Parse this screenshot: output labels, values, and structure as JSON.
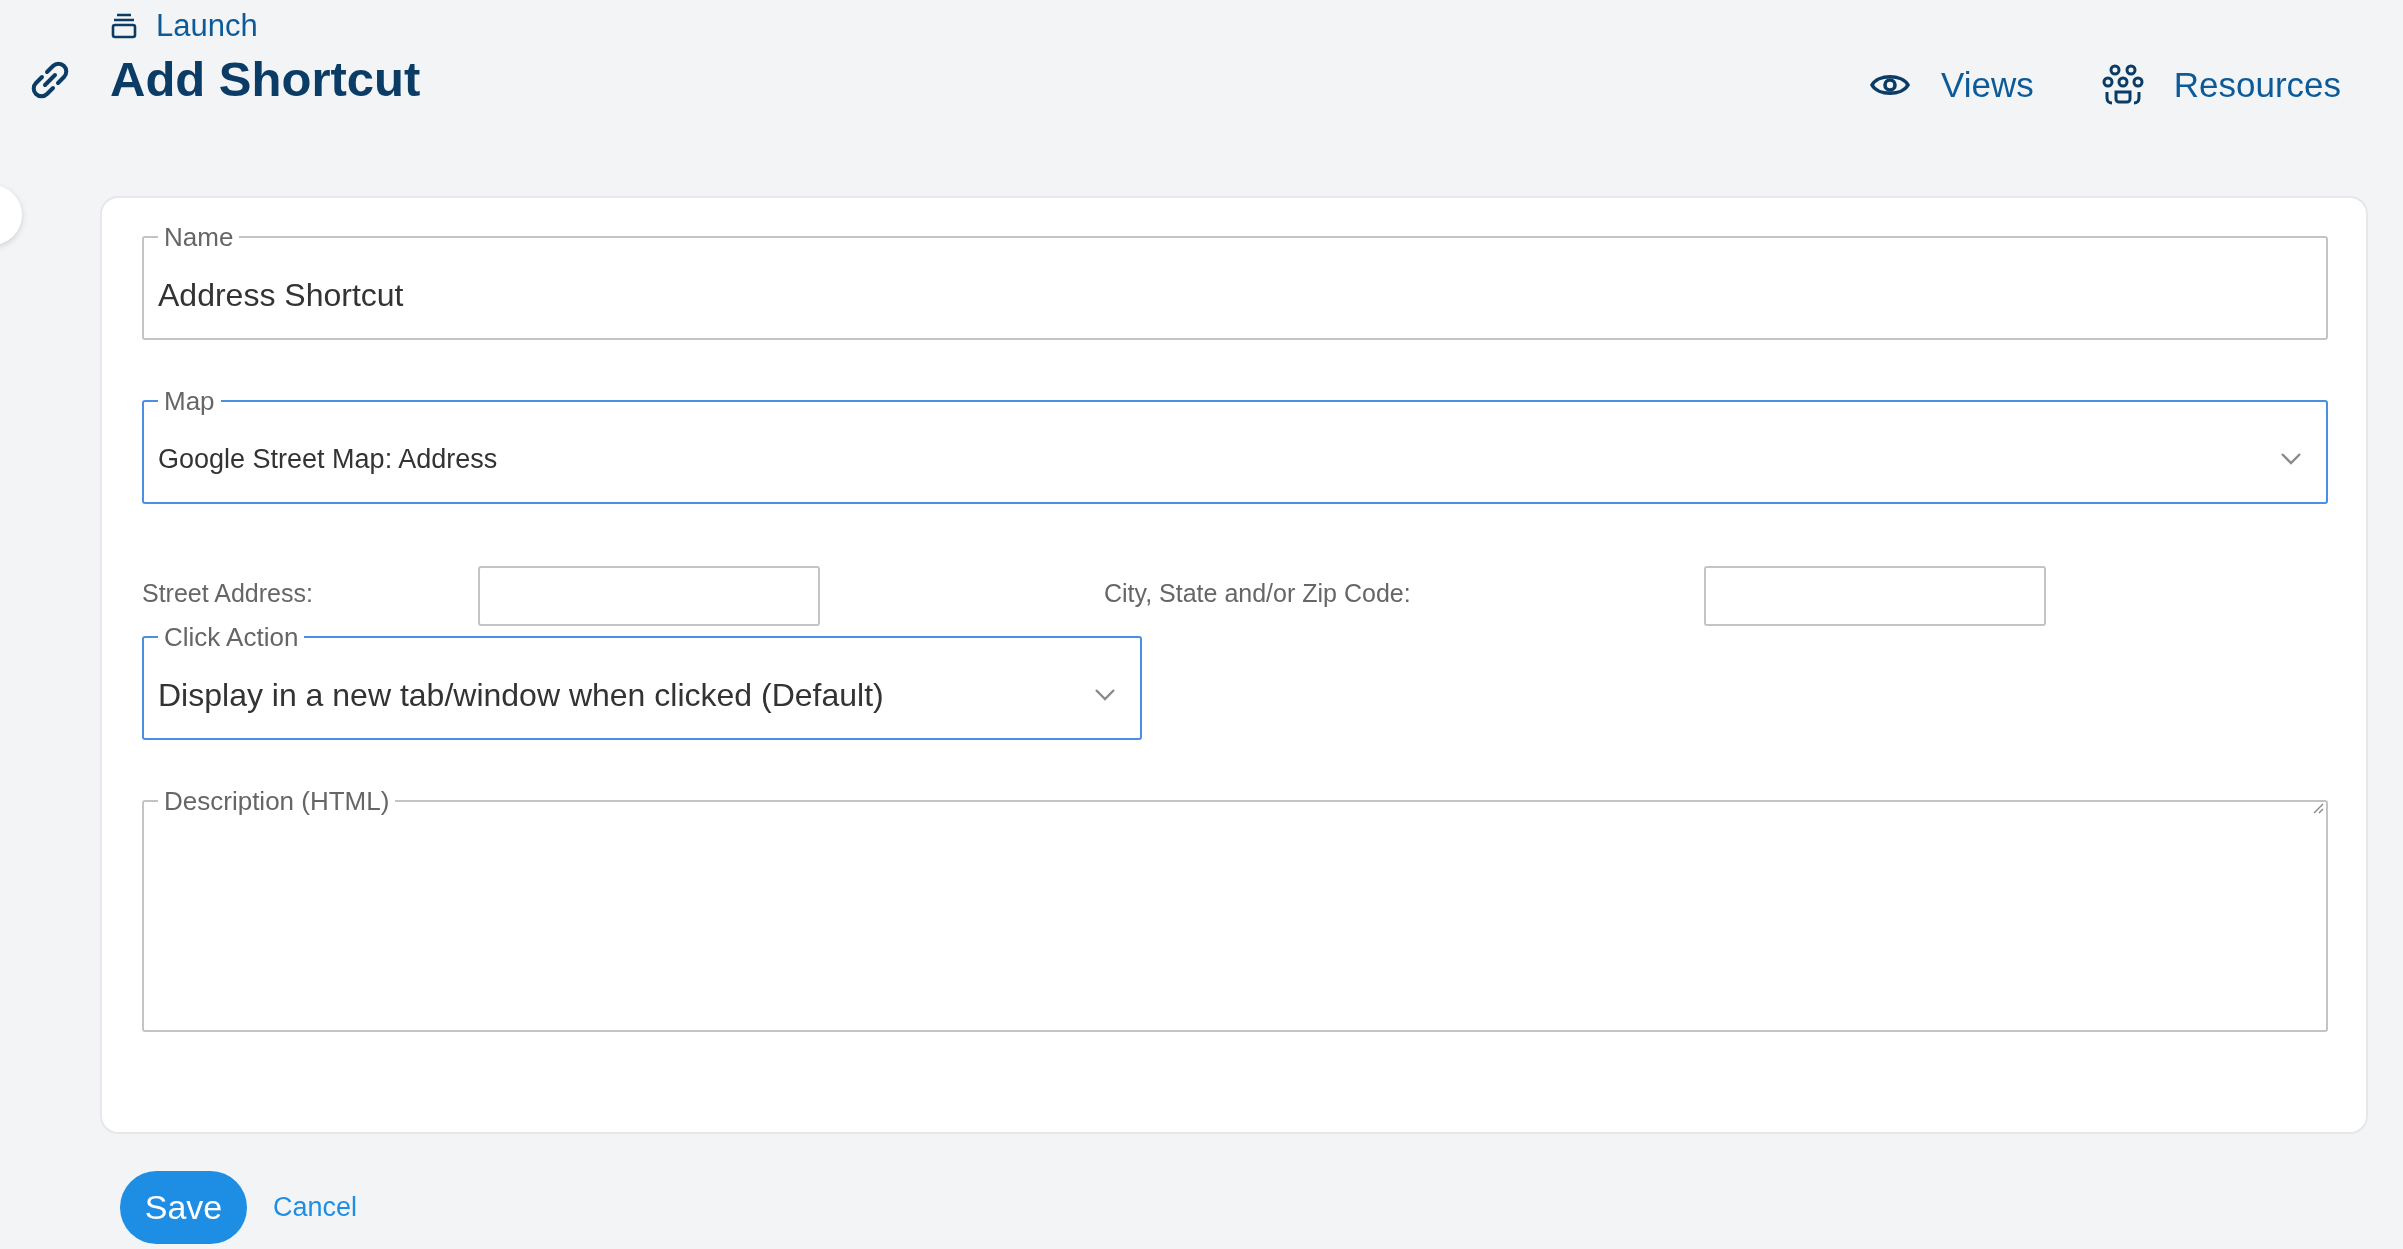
{
  "breadcrumb": {
    "label": "Launch"
  },
  "title": "Add Shortcut",
  "nav": [
    {
      "label": "Views"
    },
    {
      "label": "Resources"
    }
  ],
  "fields": [
    {
      "kind": "text",
      "label": "Name",
      "value": "Address Shortcut"
    },
    {
      "kind": "select",
      "label": "Map",
      "value": "Google Street Map: Address"
    }
  ],
  "parameters": [
    {
      "label": "Street Address:"
    },
    {
      "label": "City, State and/or Zip Code:"
    }
  ],
  "click_action": {
    "kind": "select",
    "label": "Click Action",
    "value": "Display in a new tab/window when clicked (Default)"
  },
  "description": {
    "label": "Description (HTML)"
  },
  "buttons": {
    "save": "Save",
    "cancel": "Cancel"
  }
}
